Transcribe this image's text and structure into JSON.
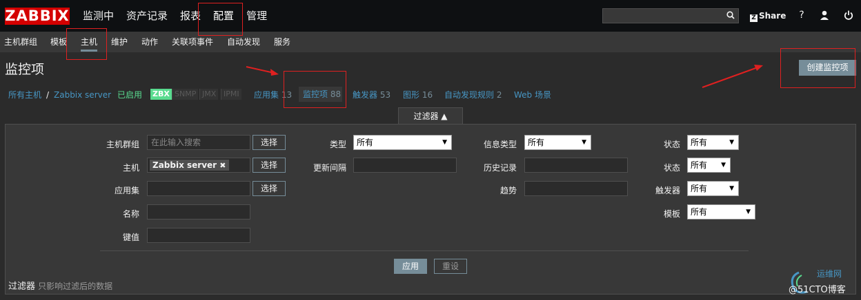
{
  "logo": "ZABBIX",
  "main_menu": [
    "监测中",
    "资产记录",
    "报表",
    "配置",
    "管理"
  ],
  "header_tools": {
    "share": "Share",
    "help": "?"
  },
  "sub_menu": [
    "主机群组",
    "模板",
    "主机",
    "维护",
    "动作",
    "关联项事件",
    "自动发现",
    "服务"
  ],
  "page_title": "监控项",
  "create_button": "创建监控项",
  "breadcrumb": {
    "all_hosts": "所有主机",
    "separator": "/",
    "host": "Zabbix server",
    "status": "已启用"
  },
  "availability_tags": [
    "ZBX",
    "SNMP",
    "JMX",
    "IPMI"
  ],
  "host_tabs": [
    {
      "label": "应用集",
      "count": "13"
    },
    {
      "label": "监控项",
      "count": "88"
    },
    {
      "label": "触发器",
      "count": "53"
    },
    {
      "label": "图形",
      "count": "16"
    },
    {
      "label": "自动发现规则",
      "count": "2"
    },
    {
      "label": "Web 场景",
      "count": ""
    }
  ],
  "filter": {
    "tab_label": "过滤器 ▲",
    "host_group_label": "主机群组",
    "host_group_placeholder": "在此输入搜索",
    "select_label": "选择",
    "host_label": "主机",
    "host_chip": "Zabbix server",
    "app_label": "应用集",
    "name_label": "名称",
    "key_label": "键值",
    "type_label": "类型",
    "type_value": "所有",
    "interval_label": "更新间隔",
    "info_type_label": "信息类型",
    "info_type_value": "所有",
    "history_label": "历史记录",
    "trends_label": "趋势",
    "status_label": "状态",
    "status_value": "所有",
    "status2_label": "状态",
    "status2_value": "所有",
    "triggers_label": "触发器",
    "triggers_value": "所有",
    "template_label": "模板",
    "template_value": "所有",
    "apply": "应用",
    "reset": "重设"
  },
  "filter_footer": {
    "title": "过滤器",
    "note": "只影响过滤后的数据"
  },
  "watermark": {
    "text": "@51CTO博客",
    "site": "运维网"
  },
  "colors": {
    "accent": "#768d99",
    "link": "#4796c4",
    "logo": "#d40000",
    "enabled": "#59db8f",
    "annotation": "#e02020"
  }
}
